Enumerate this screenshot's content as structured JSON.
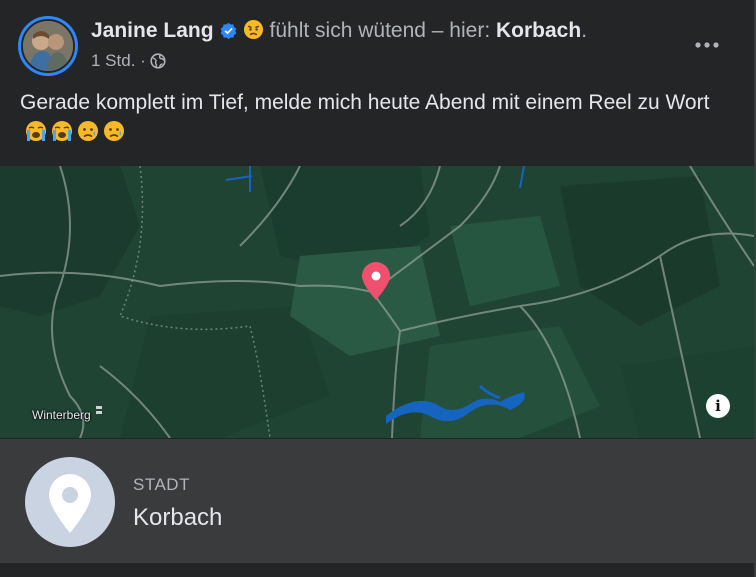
{
  "post": {
    "author": "Janine Lang",
    "verified": true,
    "feeling_emoji": "angry-face",
    "feeling_text": "fühlt sich wütend – hier:",
    "location": "Korbach",
    "location_period": ".",
    "timestamp": "1 Std. ·",
    "audience_icon": "globe-icon",
    "text": "Gerade komplett im Tief, melde mich heute Abend mit einem Reel zu Wort",
    "text_emojis": [
      "loudly-crying-face",
      "loudly-crying-face",
      "sad-but-relieved-face",
      "sad-but-relieved-face"
    ]
  },
  "map": {
    "town_label": "Winterberg",
    "info_button": "i"
  },
  "place_card": {
    "category": "STADT",
    "name": "Korbach"
  },
  "colors": {
    "background": "#242526",
    "map_forest": "#1e4032",
    "water": "#1565c0",
    "pin": "#f0506e",
    "verified": "#2d88ff"
  }
}
